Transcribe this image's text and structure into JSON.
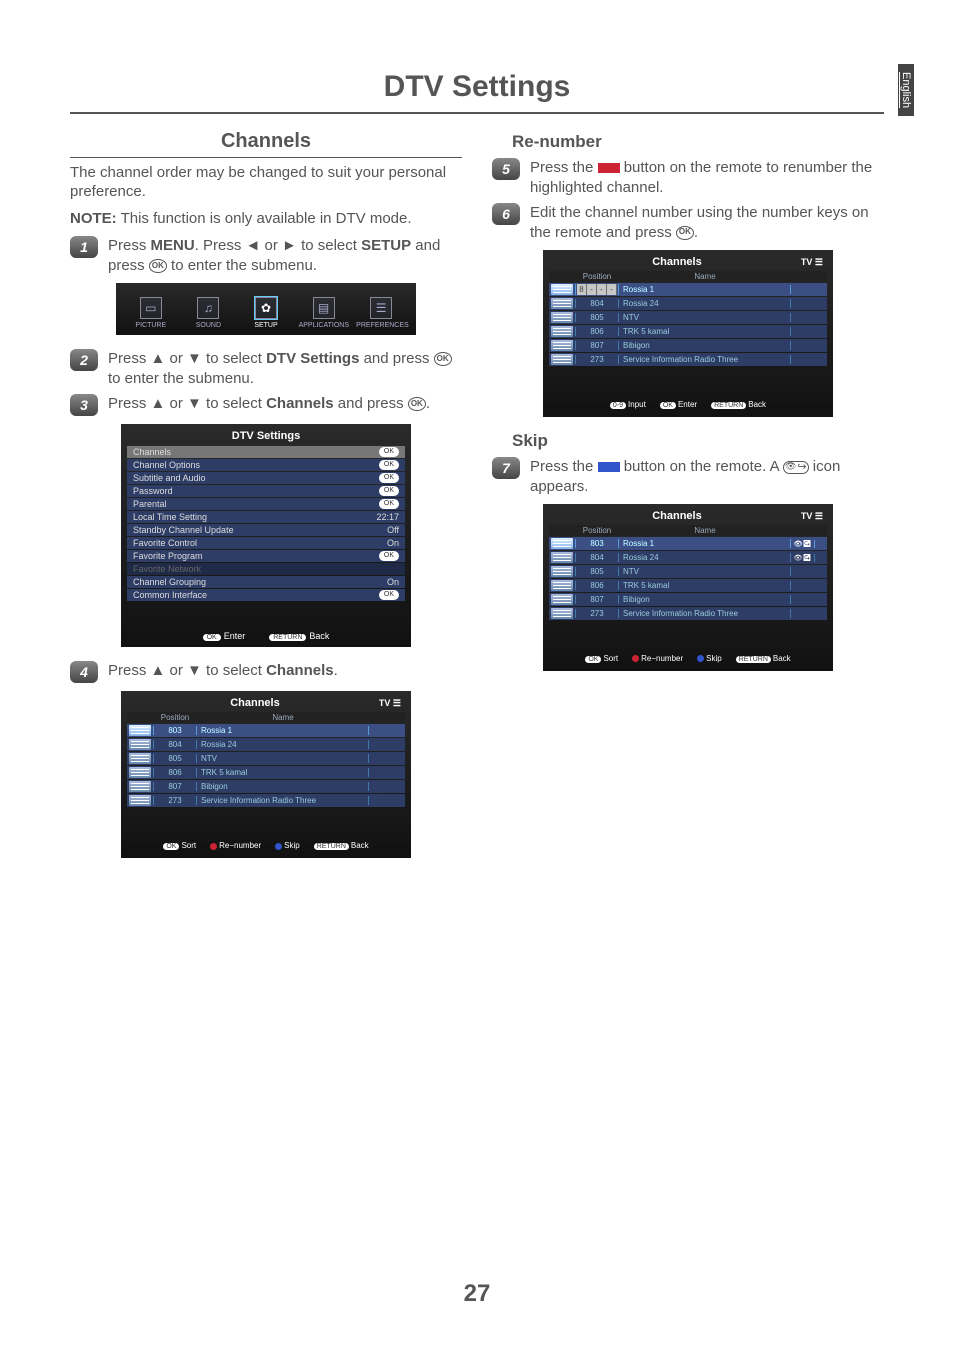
{
  "page": {
    "title": "DTV Settings",
    "language_tab": "English",
    "number": "27"
  },
  "left": {
    "heading": "Channels",
    "intro": "The channel order may be changed to suit your personal preference.",
    "note_prefix": "NOTE:",
    "note_text": " This function is only available in DTV mode.",
    "step1_a": "Press ",
    "step1_menu": "MENU",
    "step1_b": ". Press ◄ or ► to select ",
    "step1_setup": "SETUP",
    "step1_c": " and press ",
    "step1_d": " to enter  the submenu.",
    "step2_a": "Press ▲ or ▼ to select ",
    "step2_dtv": "DTV Settings",
    "step2_b": " and press ",
    "step2_c": " to enter the submenu.",
    "step3_a": "Press ▲ or ▼ to select ",
    "step3_ch": "Channels",
    "step3_b": " and press ",
    "step3_c": ".",
    "step4_a": "Press ▲ or ▼ to select ",
    "step4_ch": "Channels",
    "step4_b": "."
  },
  "osd_setup": {
    "tabs": [
      "PICTURE",
      "SOUND",
      "SETUP",
      "APPLICATIONS",
      "PREFERENCES"
    ]
  },
  "osd_dtv": {
    "title": "DTV Settings",
    "rows": [
      {
        "label": "Channels",
        "value": "OK",
        "sel": true
      },
      {
        "label": "Channel Options",
        "value": "OK"
      },
      {
        "label": "Subtitle and Audio",
        "value": "OK"
      },
      {
        "label": "Password",
        "value": "OK"
      },
      {
        "label": "Parental",
        "value": "OK"
      },
      {
        "label": "Local Time Setting",
        "value": "22:17"
      },
      {
        "label": "Standby Channel Update",
        "value": "Off"
      },
      {
        "label": "Favorite Control",
        "value": "On"
      },
      {
        "label": "Favorite Program",
        "value": "OK"
      },
      {
        "label": "Favorite Network",
        "value": "",
        "dim": true
      },
      {
        "label": "Channel Grouping",
        "value": "On"
      },
      {
        "label": "Common Interface",
        "value": "OK"
      }
    ],
    "footer": {
      "ok": "OK",
      "enter": "Enter",
      "return": "RETURN",
      "back": "Back"
    }
  },
  "osd_ch4": {
    "title": "Channels",
    "tv": "TV",
    "head": {
      "pos": "Position",
      "name": "Name"
    },
    "rows": [
      {
        "pos": "803",
        "name": "Rossia 1",
        "sel": true
      },
      {
        "pos": "804",
        "name": "Rossia 24"
      },
      {
        "pos": "805",
        "name": "NTV"
      },
      {
        "pos": "806",
        "name": "TRK 5 kamal"
      },
      {
        "pos": "807",
        "name": "Bibigon"
      },
      {
        "pos": "273",
        "name": "Service Information Radio Three"
      }
    ],
    "footer": {
      "ok": "OK",
      "sort": "Sort",
      "renum": "Re−number",
      "skip": "Skip",
      "return": "RETURN",
      "back": "Back"
    }
  },
  "right": {
    "renumber_heading": "Re-number",
    "step5_a": "Press the ",
    "step5_b": " button on the remote to renumber the highlighted channel.",
    "step6_a": "Edit the channel number using the number keys on the remote and press ",
    "step6_b": ".",
    "skip_heading": "Skip",
    "step7_a": "Press the ",
    "step7_b": " button on the remote. A ",
    "step7_c": " icon appears."
  },
  "osd_ch6": {
    "title": "Channels",
    "tv": "TV",
    "head": {
      "pos": "Position",
      "name": "Name"
    },
    "input": [
      "8",
      "-",
      "-",
      "-"
    ],
    "rows": [
      {
        "pos": "input",
        "name": "Rossia 1",
        "sel": true
      },
      {
        "pos": "804",
        "name": "Rossia 24"
      },
      {
        "pos": "805",
        "name": "NTV"
      },
      {
        "pos": "806",
        "name": "TRK 5 kamal"
      },
      {
        "pos": "807",
        "name": "Bibigon"
      },
      {
        "pos": "273",
        "name": "Service Information Radio Three"
      }
    ],
    "footer": {
      "pill1": "0-9",
      "input": "Input",
      "ok": "OK",
      "enter": "Enter",
      "return": "RETURN",
      "back": "Back"
    }
  },
  "osd_ch7": {
    "title": "Channels",
    "tv": "TV",
    "head": {
      "pos": "Position",
      "name": "Name"
    },
    "rows": [
      {
        "pos": "803",
        "name": "Rossia 1",
        "sel": true,
        "skip": true
      },
      {
        "pos": "804",
        "name": "Rossia 24",
        "skip": true
      },
      {
        "pos": "805",
        "name": "NTV"
      },
      {
        "pos": "806",
        "name": "TRK 5 kamal"
      },
      {
        "pos": "807",
        "name": "Bibigon"
      },
      {
        "pos": "273",
        "name": "Service Information Radio Three"
      }
    ],
    "footer": {
      "ok": "OK",
      "sort": "Sort",
      "renum": "Re−number",
      "skip": "Skip",
      "return": "RETURN",
      "back": "Back"
    }
  }
}
